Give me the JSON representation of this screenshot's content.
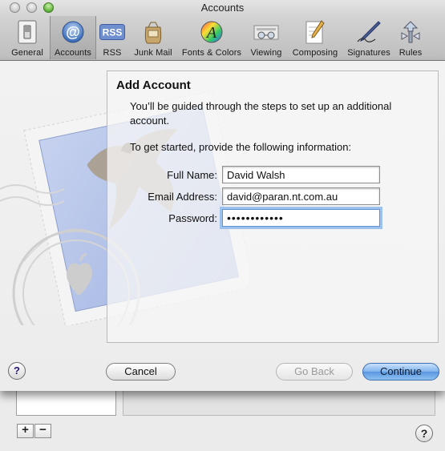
{
  "window": {
    "title": "Accounts"
  },
  "toolbar": {
    "items": [
      {
        "label": "General",
        "icon": "light-switch-icon"
      },
      {
        "label": "Accounts",
        "icon": "at-sign-icon",
        "selected": true
      },
      {
        "label": "RSS",
        "icon": "rss-icon"
      },
      {
        "label": "Junk Mail",
        "icon": "junk-bag-icon"
      },
      {
        "label": "Fonts & Colors",
        "icon": "fonts-colors-icon"
      },
      {
        "label": "Viewing",
        "icon": "glasses-icon"
      },
      {
        "label": "Composing",
        "icon": "pencil-paper-icon"
      },
      {
        "label": "Signatures",
        "icon": "fountain-pen-icon"
      },
      {
        "label": "Rules",
        "icon": "rules-icon"
      }
    ]
  },
  "sheet": {
    "heading": "Add Account",
    "intro": "You’ll be guided through the steps to set up an additional account.",
    "prompt": "To get started, provide the following information:",
    "full_name": {
      "label": "Full Name:",
      "value": "David Walsh"
    },
    "email": {
      "label": "Email Address:",
      "value": "david@paran.nt.com.au"
    },
    "password": {
      "label": "Password:",
      "value": "••••••••••••"
    },
    "buttons": {
      "cancel": "Cancel",
      "go_back": "Go Back",
      "continue": "Continue",
      "help": "?"
    }
  },
  "prefs": {
    "add_label": "+",
    "remove_label": "−",
    "help_label": "?"
  },
  "colors": {
    "accent": "#5a97e0",
    "focus_ring": "#9dc2ee"
  }
}
